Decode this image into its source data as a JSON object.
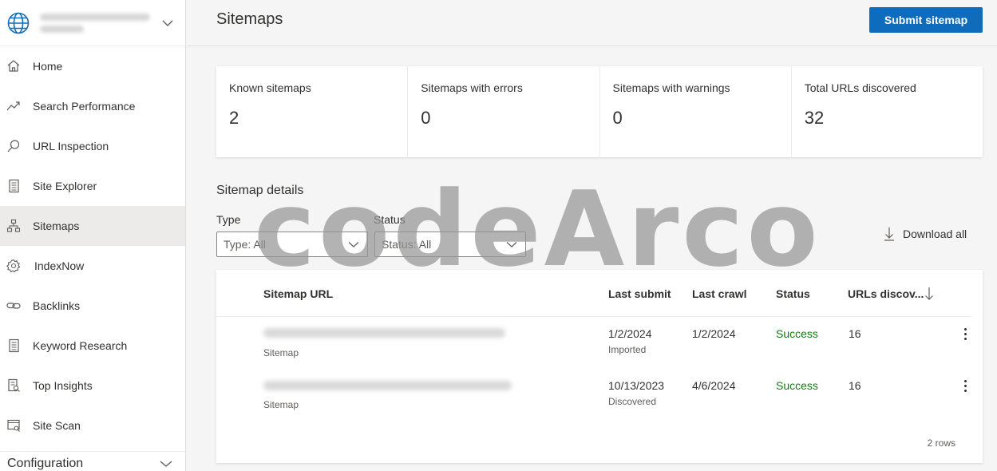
{
  "sidebar": {
    "items": [
      {
        "label": "Home",
        "icon": "home-icon"
      },
      {
        "label": "Search Performance",
        "icon": "trend-icon"
      },
      {
        "label": "URL Inspection",
        "icon": "search-icon"
      },
      {
        "label": "Site Explorer",
        "icon": "document-icon"
      },
      {
        "label": "Sitemaps",
        "icon": "sitemap-icon",
        "active": true
      },
      {
        "label": "IndexNow",
        "icon": "gear-icon"
      },
      {
        "label": "Backlinks",
        "icon": "link-icon"
      },
      {
        "label": "Keyword Research",
        "icon": "document-icon"
      },
      {
        "label": "Top Insights",
        "icon": "report-icon"
      },
      {
        "label": "Site Scan",
        "icon": "scan-icon"
      }
    ],
    "configuration_label": "Configuration"
  },
  "header": {
    "title": "Sitemaps",
    "submit_label": "Submit sitemap"
  },
  "stats": [
    {
      "label": "Known sitemaps",
      "value": "2"
    },
    {
      "label": "Sitemaps with errors",
      "value": "0"
    },
    {
      "label": "Sitemaps with warnings",
      "value": "0"
    },
    {
      "label": "Total URLs discovered",
      "value": "32"
    }
  ],
  "details": {
    "title": "Sitemap details",
    "type_label": "Type",
    "type_value": "Type: All",
    "status_label": "Status",
    "status_value": "Status: All",
    "download_label": "Download all"
  },
  "table": {
    "columns": [
      "Sitemap URL",
      "Last submit",
      "Last crawl",
      "Status",
      "URLs discov..."
    ],
    "rows": [
      {
        "kind": "Sitemap",
        "last_submit": "1/2/2024",
        "submit_note": "Imported",
        "last_crawl": "1/2/2024",
        "status": "Success",
        "urls": "16"
      },
      {
        "kind": "Sitemap",
        "last_submit": "10/13/2023",
        "submit_note": "Discovered",
        "last_crawl": "4/6/2024",
        "status": "Success",
        "urls": "16"
      }
    ],
    "row_count": "2 rows"
  },
  "watermark": "codeArco",
  "colors": {
    "accent": "#0f6cbd",
    "success": "#107c10",
    "active_nav": "#edebe9"
  }
}
